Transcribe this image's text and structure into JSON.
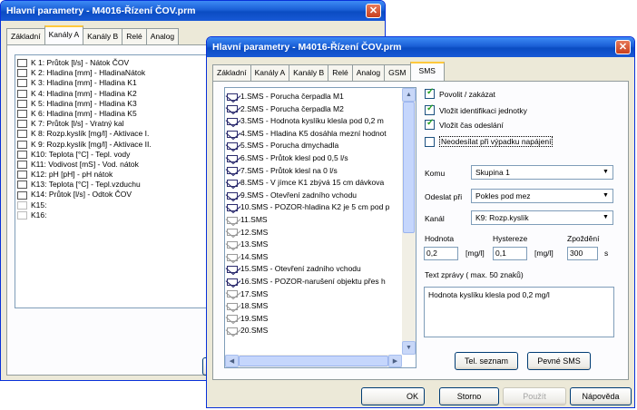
{
  "back_window": {
    "title": "Hlavní parametry - M4016-Řízení ČOV.prm",
    "tabs": [
      "Základní",
      "Kanály A",
      "Kanály B",
      "Relé",
      "Analog"
    ],
    "active_tab": "Kanály A",
    "channels": [
      {
        "label": "K 1: Průtok [l/s] - Nátok ČOV",
        "defined": true
      },
      {
        "label": "K 2: Hladina [mm] - HladinaNátok",
        "defined": true
      },
      {
        "label": "K 3: Hladina [mm] - Hladina K1",
        "defined": true
      },
      {
        "label": "K 4: Hladina [mm] - Hladina K2",
        "defined": true
      },
      {
        "label": "K 5: Hladina [mm] - Hladina K3",
        "defined": true
      },
      {
        "label": "K 6: Hladina [mm] - Hladina K5",
        "defined": true
      },
      {
        "label": "K 7: Průtok [l/s] - Vratný kal",
        "defined": true
      },
      {
        "label": "K 8: Rozp.kyslík [mg/l] - Aktivace I.",
        "defined": true
      },
      {
        "label": "K 9: Rozp.kyslík [mg/l] - Aktivace II.",
        "defined": true
      },
      {
        "label": "K10: Teplota [°C] - Tepl. vody",
        "defined": true
      },
      {
        "label": "K11: Vodivost [mS] - Vod. nátok",
        "defined": true
      },
      {
        "label": "K12: pH [pH] - pH nátok",
        "defined": true
      },
      {
        "label": "K13: Teplota [°C] - Tepl.vzduchu",
        "defined": true
      },
      {
        "label": "K14: Průtok [l/s] - Odtok ČOV",
        "defined": true
      },
      {
        "label": "K15:",
        "defined": false
      },
      {
        "label": "K16:",
        "defined": false
      }
    ],
    "partial_button": "("
  },
  "front_window": {
    "title": "Hlavní parametry - M4016-Řízení ČOV.prm",
    "tabs": [
      "Základní",
      "Kanály A",
      "Kanály B",
      "Relé",
      "Analog",
      "GSM",
      "SMS"
    ],
    "active_tab": "SMS",
    "sms_list": [
      {
        "label": "1.SMS - Porucha čerpadla M1",
        "defined": true
      },
      {
        "label": "2.SMS - Porucha čerpadla M2",
        "defined": true
      },
      {
        "label": "3.SMS - Hodnota kyslíku klesla pod  0,2 m",
        "defined": true
      },
      {
        "label": "4.SMS - Hladina K5 dosáhla mezní hodnot",
        "defined": true
      },
      {
        "label": "5.SMS - Porucha dmychadla",
        "defined": true
      },
      {
        "label": "6.SMS - Průtok klesl pod 0,5 l/s",
        "defined": true
      },
      {
        "label": "7.SMS - Průtok klesl na 0 l/s",
        "defined": true
      },
      {
        "label": "8.SMS - V jímce K1 zbývá 15 cm dávkova",
        "defined": true
      },
      {
        "label": "9.SMS - Otevření zadního vchodu",
        "defined": true
      },
      {
        "label": "10.SMS - POZOR-hladina K2 je 5 cm pod p",
        "defined": true
      },
      {
        "label": "11.SMS",
        "defined": false
      },
      {
        "label": "12.SMS",
        "defined": false
      },
      {
        "label": "13.SMS",
        "defined": false
      },
      {
        "label": "14.SMS",
        "defined": false
      },
      {
        "label": "15.SMS - Otevření zadního vchodu",
        "defined": true
      },
      {
        "label": "16.SMS - POZOR-narušení objektu přes h",
        "defined": true
      },
      {
        "label": "17.SMS",
        "defined": false
      },
      {
        "label": "18.SMS",
        "defined": false
      },
      {
        "label": "19.SMS",
        "defined": false
      },
      {
        "label": "20.SMS",
        "defined": false
      }
    ],
    "options": {
      "povolit": {
        "label": "Povolit / zakázat",
        "checked": true
      },
      "vlozit_id": {
        "label": "Vložit identifikaci jednotky",
        "checked": true
      },
      "vlozit_cas": {
        "label": "Vložit čas odeslání",
        "checked": true
      },
      "neodesilat": {
        "label": "Neodesílat při výpadku napájení",
        "checked": false
      }
    },
    "komu": {
      "label": "Komu",
      "value": "Skupina 1"
    },
    "odeslat_pri": {
      "label": "Odeslat při",
      "value": "Pokles pod mez"
    },
    "kanal": {
      "label": "Kanál",
      "value": "K9: Rozp.kyslík"
    },
    "hodnota": {
      "label": "Hodnota",
      "value": "0,2",
      "unit": "[mg/l]"
    },
    "hystereze": {
      "label": "Hystereze",
      "value": "0,1",
      "unit": "[mg/l]"
    },
    "zpozdeni": {
      "label": "Zpoždění",
      "value": "300",
      "unit": "s"
    },
    "text_label": "Text zprávy ( max. 50 znaků)",
    "text_value": "Hodnota kyslíku klesla pod  0,2 mg/l",
    "buttons": {
      "tel_seznam": "Tel. seznam",
      "pevne_sms": "Pevné SMS",
      "ok": "OK",
      "storno": "Storno",
      "pouzit": "Použít",
      "napoveda": "Nápověda"
    }
  },
  "icons": {
    "close": "close-icon",
    "list_item": "envelope-icon",
    "channel": "channel-icon"
  },
  "colors": {
    "titlebar": "#0a4cc2",
    "dialog_bg": "#ece9d8",
    "close_button": "#c8401e",
    "tab_highlight": "#ffc83c"
  }
}
